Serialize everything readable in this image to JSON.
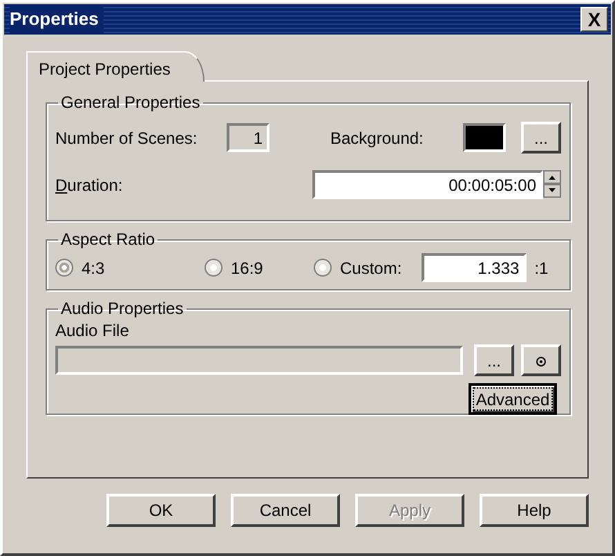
{
  "window": {
    "title": "Properties",
    "close": "X"
  },
  "tabs": [
    {
      "label": "Project Properties",
      "selected": true
    }
  ],
  "general": {
    "title": "General Properties",
    "scenes_label": "Number of Scenes:",
    "scenes_value": "1",
    "background_label": "Background:",
    "swatch": {
      "color": "#000000"
    },
    "browse": "...",
    "duration_label": "Duration:",
    "duration_mnemonic": true,
    "duration_value": "00:00:05:00"
  },
  "aspect": {
    "title": "Aspect Ratio",
    "options": [
      {
        "label": "4:3",
        "selected": true
      },
      {
        "label": "16:9",
        "selected": false
      },
      {
        "label": "Custom:",
        "selected": false
      }
    ],
    "custom_value": "1.333",
    "suffix": ":1"
  },
  "audio": {
    "title": "Audio Properties",
    "file_label": "Audio File",
    "file_disabled": true,
    "browse": "...",
    "advanced": "Advanced",
    "advanced_focused": true
  },
  "buttons": [
    {
      "label": "OK",
      "disabled": false
    },
    {
      "label": "Cancel",
      "disabled": false
    },
    {
      "label": "Apply",
      "disabled": true
    },
    {
      "label": "Help",
      "disabled": false
    }
  ]
}
